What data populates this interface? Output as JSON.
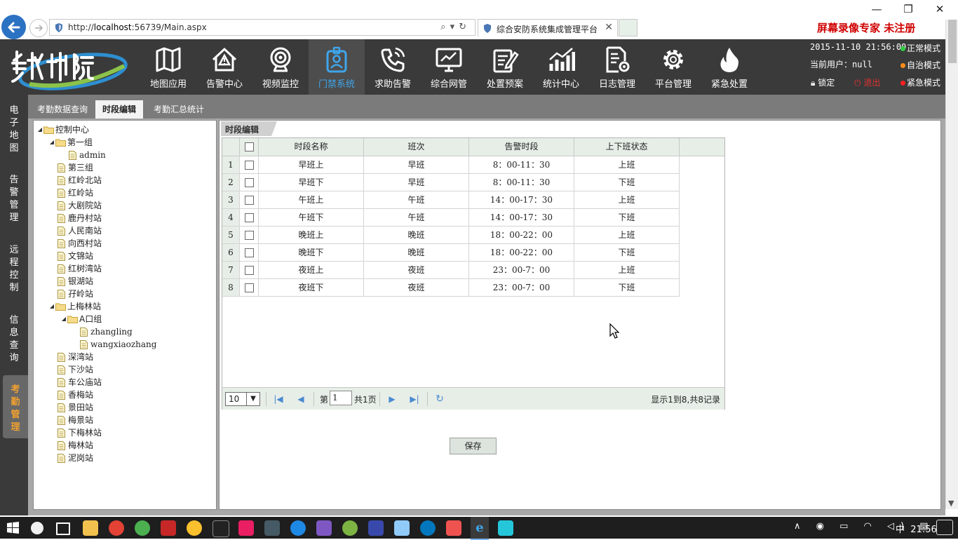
{
  "browser": {
    "url_prefix": "http://",
    "url_host": "localhost",
    "url_rest": ":56739/Main.aspx",
    "tab_title": "综合安防系统集成管理平台",
    "recorder_text": "屏幕录像专家 未注册"
  },
  "header": {
    "menus": [
      {
        "label": "地图应用",
        "icon": "map-icon"
      },
      {
        "label": "告警中心",
        "icon": "warning-house-icon"
      },
      {
        "label": "视频监控",
        "icon": "camera-icon"
      },
      {
        "label": "门禁系统",
        "icon": "badge-icon",
        "active": true
      },
      {
        "label": "求助告警",
        "icon": "phone-icon"
      },
      {
        "label": "综合网管",
        "icon": "monitor-chart-icon"
      },
      {
        "label": "处置预案",
        "icon": "notepad-icon"
      },
      {
        "label": "统计中心",
        "icon": "bar-chart-icon"
      },
      {
        "label": "日志管理",
        "icon": "doc-gear-icon"
      },
      {
        "label": "平台管理",
        "icon": "gear-icon"
      },
      {
        "label": "紧急处置",
        "icon": "flame-icon"
      }
    ],
    "datetime": "2015-11-10 21:56:00",
    "user_label": "当前用户：",
    "user_value": "null",
    "lock_label": "锁定",
    "exit_label": "退出",
    "modes": [
      {
        "label": "正常模式",
        "color": "#2ecc40"
      },
      {
        "label": "自治模式",
        "color": "#ff8c1a"
      },
      {
        "label": "紧急模式",
        "color": "#ff2020"
      }
    ]
  },
  "leftnav": [
    {
      "label": "电子地图"
    },
    {
      "label": "告警管理"
    },
    {
      "label": "远程控制"
    },
    {
      "label": "信息查询"
    },
    {
      "label": "考勤管理",
      "active": true
    }
  ],
  "subtabs": [
    {
      "label": "考勤数据查询"
    },
    {
      "label": "时段编辑",
      "active": true
    },
    {
      "label": "考勤汇总统计"
    }
  ],
  "tree": [
    {
      "label": "控制中心",
      "level": 0,
      "type": "folder",
      "expanded": true
    },
    {
      "label": "第一组",
      "level": 1,
      "type": "folder",
      "expanded": true
    },
    {
      "label": "admin",
      "level": 2,
      "type": "doc",
      "serif": true
    },
    {
      "label": "第三组",
      "level": 1,
      "type": "doc"
    },
    {
      "label": "红岭北站",
      "level": 1,
      "type": "doc"
    },
    {
      "label": "红岭站",
      "level": 1,
      "type": "doc"
    },
    {
      "label": "大剧院站",
      "level": 1,
      "type": "doc"
    },
    {
      "label": "鹿丹村站",
      "level": 1,
      "type": "doc"
    },
    {
      "label": "人民南站",
      "level": 1,
      "type": "doc"
    },
    {
      "label": "向西村站",
      "level": 1,
      "type": "doc"
    },
    {
      "label": "文锦站",
      "level": 1,
      "type": "doc"
    },
    {
      "label": "红树湾站",
      "level": 1,
      "type": "doc"
    },
    {
      "label": "银湖站",
      "level": 1,
      "type": "doc"
    },
    {
      "label": "孖岭站",
      "level": 1,
      "type": "doc"
    },
    {
      "label": "上梅林站",
      "level": 1,
      "type": "folder",
      "expanded": true
    },
    {
      "label": "A口组",
      "level": 2,
      "type": "folder",
      "expanded": true
    },
    {
      "label": "zhangling",
      "level": 3,
      "type": "doc",
      "serif": true
    },
    {
      "label": "wangxiaozhang",
      "level": 3,
      "type": "doc",
      "serif": true
    },
    {
      "label": "深湾站",
      "level": 1,
      "type": "doc"
    },
    {
      "label": "下沙站",
      "level": 1,
      "type": "doc"
    },
    {
      "label": "车公庙站",
      "level": 1,
      "type": "doc"
    },
    {
      "label": "香梅站",
      "level": 1,
      "type": "doc"
    },
    {
      "label": "景田站",
      "level": 1,
      "type": "doc"
    },
    {
      "label": "梅景站",
      "level": 1,
      "type": "doc"
    },
    {
      "label": "下梅林站",
      "level": 1,
      "type": "doc"
    },
    {
      "label": "梅林站",
      "level": 1,
      "type": "doc"
    },
    {
      "label": "泥岗站",
      "level": 1,
      "type": "doc"
    }
  ],
  "panel": {
    "title": "时段编辑",
    "columns": [
      "时段名称",
      "班次",
      "告警时段",
      "上下班状态"
    ],
    "rows": [
      {
        "num": "1",
        "name": "早班上",
        "shift": "早班",
        "time": "8：00-11：30",
        "status": "上班"
      },
      {
        "num": "2",
        "name": "早班下",
        "shift": "早班",
        "time": "8：00-11：30",
        "status": "下班"
      },
      {
        "num": "3",
        "name": "午班上",
        "shift": "午班",
        "time": "14：00-17：30",
        "status": "上班"
      },
      {
        "num": "4",
        "name": "午班下",
        "shift": "午班",
        "time": "14：00-17：30",
        "status": "下班"
      },
      {
        "num": "5",
        "name": "晚班上",
        "shift": "晚班",
        "time": "18：00-22：00",
        "status": "上班"
      },
      {
        "num": "6",
        "name": "晚班下",
        "shift": "晚班",
        "time": "18：00-22：00",
        "status": "下班"
      },
      {
        "num": "7",
        "name": "夜班上",
        "shift": "夜班",
        "time": "23：00-7：00",
        "status": "上班"
      },
      {
        "num": "8",
        "name": "夜班下",
        "shift": "夜班",
        "time": "23：00-7：00",
        "status": "下班"
      }
    ],
    "pager": {
      "page_size": "10",
      "page_prefix": "第",
      "page_value": "1",
      "page_total": "共1页",
      "info": "显示1到8,共8记录"
    },
    "save_label": "保存"
  },
  "taskbar": {
    "ime": "中",
    "time": "21:56"
  }
}
